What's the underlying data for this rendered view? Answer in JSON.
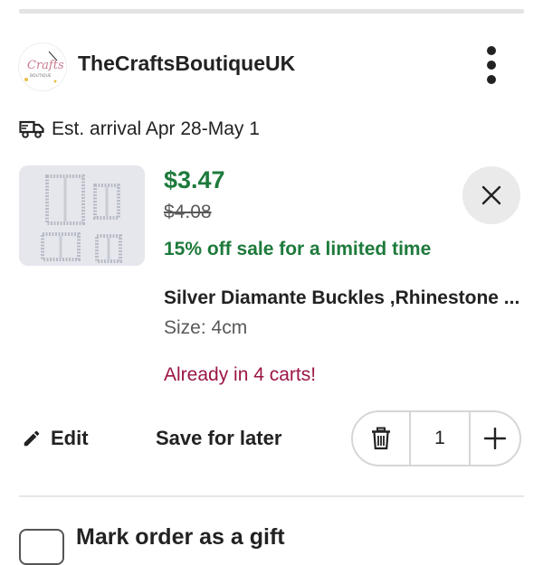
{
  "shop": {
    "name": "TheCraftsBoutiqueUK",
    "logo_text": "Crafts",
    "logo_subtext": "BOUTIQUE",
    "menu_icon": "kebab-menu-icon"
  },
  "shipping": {
    "icon": "delivery-truck-icon",
    "arrival_text": "Est. arrival Apr 28-May 1"
  },
  "item": {
    "price": "$3.47",
    "original_price": "$4.08",
    "sale_text": "15% off sale for a limited time",
    "title": "Silver Diamante Buckles ,Rhinestone Buckles",
    "size": "Size: 4cm",
    "cart_notice": "Already in 4 carts!",
    "quantity": "1"
  },
  "actions": {
    "edit_label": "Edit",
    "save_for_later_label": "Save for later"
  },
  "gift": {
    "label": "Mark order as a gift"
  },
  "colors": {
    "price_green": "#1d7a3b",
    "alert_red": "#9b1546",
    "muted_text": "#595959"
  }
}
